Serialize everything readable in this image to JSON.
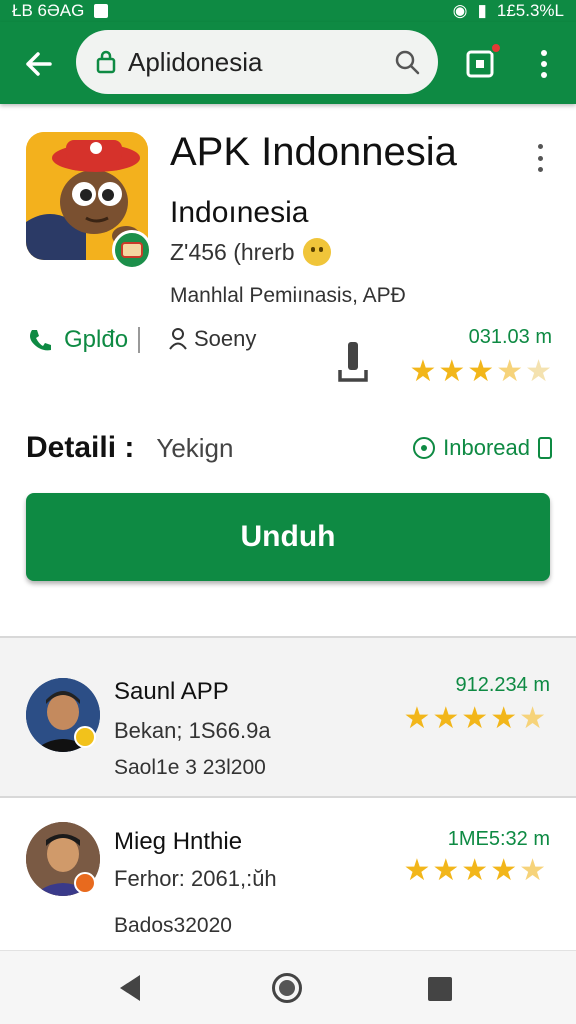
{
  "status_bar": {
    "left_text": "ŁB 6ƏAG",
    "right_text": "1£5.3%L"
  },
  "search": {
    "text": "Aplidonesia"
  },
  "app": {
    "title": "APK Indonnesia",
    "subtitle": "Indoınesia",
    "meta": "Z'456 (hrerb",
    "publisher": "Manhlal Pemiınasis, APÐ"
  },
  "stats": {
    "left_label": "Gplđo",
    "mid_label": "Soeny",
    "value": "031.03 m",
    "rating": 3.5
  },
  "details": {
    "label": "Detaili :",
    "value": "Yekign",
    "right_label": "Inboread"
  },
  "download": {
    "label": "Unduh"
  },
  "list": [
    {
      "name": "Saunl APP",
      "line2": "Bekan; 1S66.9a",
      "line3": "Saol1e 3 23l200",
      "value": "912.234 m",
      "rating": 4.5
    },
    {
      "name": "Mieg Hnthie",
      "line2": "Ferhor: 2061,:ŭh",
      "line3": "Bados32020",
      "value": "1ME5:32 m",
      "rating": 4.5
    }
  ],
  "colors": {
    "accent": "#0e8a43",
    "star": "#f2b61a"
  }
}
